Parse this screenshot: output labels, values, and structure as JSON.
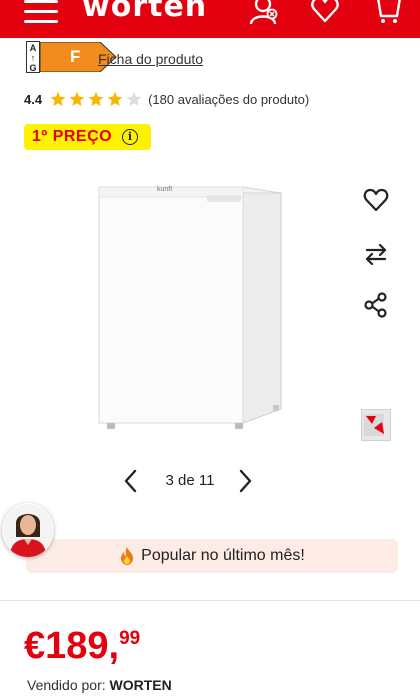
{
  "header": {
    "logo_text": "worten",
    "icons": [
      "menu-icon",
      "account-icon",
      "favorites-icon",
      "cart-icon"
    ]
  },
  "energy": {
    "scale_letters": [
      "A",
      "↑",
      "G"
    ],
    "class": "F",
    "class_color": "#f28c1f",
    "sheet_link": "Ficha do produto"
  },
  "rating": {
    "value": "4.4",
    "stars_filled": 4,
    "stars_total": 5,
    "count_text": "(180 avaliações do produto)"
  },
  "badge": {
    "label": "1º PREÇO",
    "info_icon": "i",
    "bg_color": "#fff200",
    "text_color": "#e3000f"
  },
  "gallery": {
    "brand_label": "kunft",
    "current": "3 de 11"
  },
  "popular": {
    "text": "Popular no último mês!"
  },
  "price": {
    "currency": "€",
    "main": "189,",
    "cents": "99"
  },
  "seller": {
    "label": "Vendido por:",
    "name": "WORTEN"
  },
  "colors": {
    "brand_red": "#e3000f",
    "star_gold": "#f5b700",
    "star_empty": "#dddddd",
    "popular_bg": "#fdebe6"
  }
}
